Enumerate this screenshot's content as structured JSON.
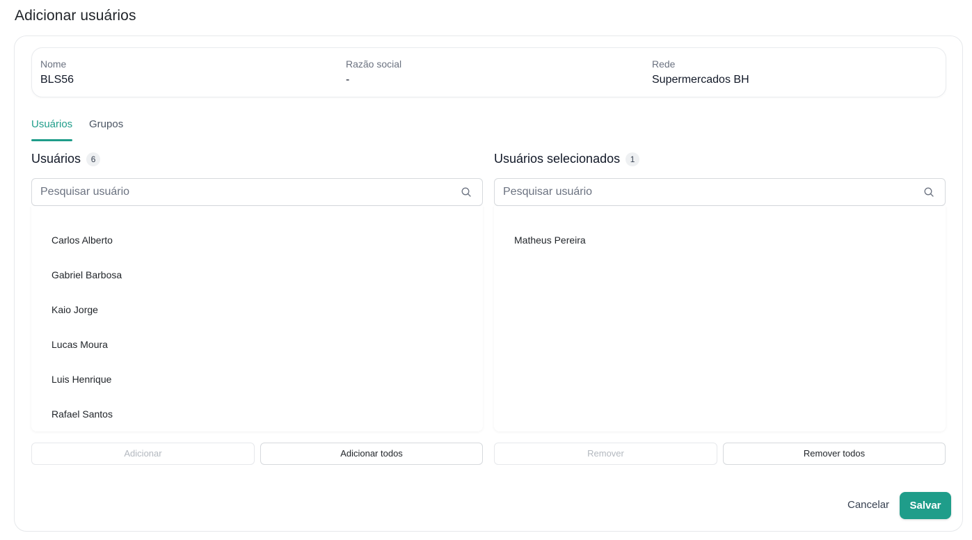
{
  "page": {
    "title": "Adicionar usuários"
  },
  "info": {
    "nome_label": "Nome",
    "nome_value": "BLS56",
    "razao_label": "Razão social",
    "razao_value": "-",
    "rede_label": "Rede",
    "rede_value": "Supermercados BH"
  },
  "tabs": [
    {
      "label": "Usuários",
      "active": true
    },
    {
      "label": "Grupos",
      "active": false
    }
  ],
  "available": {
    "title": "Usuários",
    "count": "6",
    "search_placeholder": "Pesquisar usuário",
    "items": [
      "Carlos Alberto",
      "Gabriel Barbosa",
      "Kaio Jorge",
      "Lucas Moura",
      "Luis Henrique",
      "Rafael Santos"
    ],
    "add_label": "Adicionar",
    "add_all_label": "Adicionar todos"
  },
  "selected": {
    "title": "Usuários selecionados",
    "count": "1",
    "search_placeholder": "Pesquisar usuário",
    "items": [
      "Matheus Pereira"
    ],
    "remove_label": "Remover",
    "remove_all_label": "Remover todos"
  },
  "footer": {
    "cancel_label": "Cancelar",
    "save_label": "Salvar"
  },
  "colors": {
    "accent": "#1f9d8a"
  }
}
